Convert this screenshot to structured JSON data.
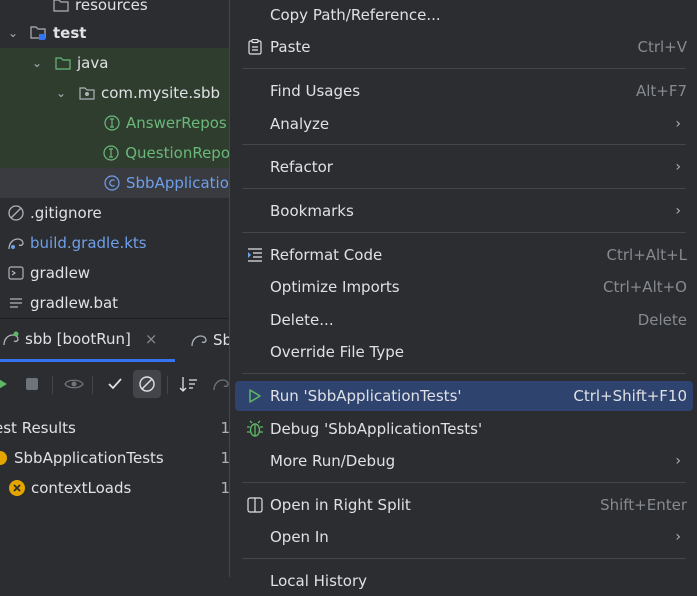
{
  "tree": {
    "resources": "resources",
    "test": "test",
    "java": "java",
    "package": "com.mysite.sbb",
    "answer_repo": "AnswerRepos",
    "question_repo": "QuestionRepo",
    "sbb_app": "SbbApplicatio",
    "gitignore": ".gitignore",
    "build_gradle": "build.gradle.kts",
    "gradlew": "gradlew",
    "gradlew_bat": "gradlew.bat"
  },
  "run_panel": {
    "tab1": "sbb [bootRun]",
    "tab1_close": "×",
    "tab2": "Sb",
    "results_label": "est Results",
    "results_count": "1",
    "suite": "SbbApplicationTests",
    "suite_count": "1",
    "test": "contextLoads",
    "test_count": "1"
  },
  "menu": {
    "copy_path": "Copy Path/Reference...",
    "paste": "Paste",
    "paste_sc": "Ctrl+V",
    "find_usages": "Find Usages",
    "find_usages_sc": "Alt+F7",
    "analyze": "Analyze",
    "refactor": "Refactor",
    "bookmarks": "Bookmarks",
    "reformat": "Reformat Code",
    "reformat_sc": "Ctrl+Alt+L",
    "optimize": "Optimize Imports",
    "optimize_sc": "Ctrl+Alt+O",
    "delete": "Delete...",
    "delete_sc": "Delete",
    "override": "Override File Type",
    "run": "Run 'SbbApplicationTests'",
    "run_sc": "Ctrl+Shift+F10",
    "debug": "Debug 'SbbApplicationTests'",
    "more_run": "More Run/Debug",
    "open_split": "Open in Right Split",
    "open_split_sc": "Shift+Enter",
    "open_in": "Open In",
    "last_partial": "Local History",
    "arrow": "›"
  },
  "colors": {
    "accent": "#3574f0",
    "highlight": "#2e436e",
    "green_text": "#6ab87a",
    "blue_text": "#6f9fe9"
  }
}
